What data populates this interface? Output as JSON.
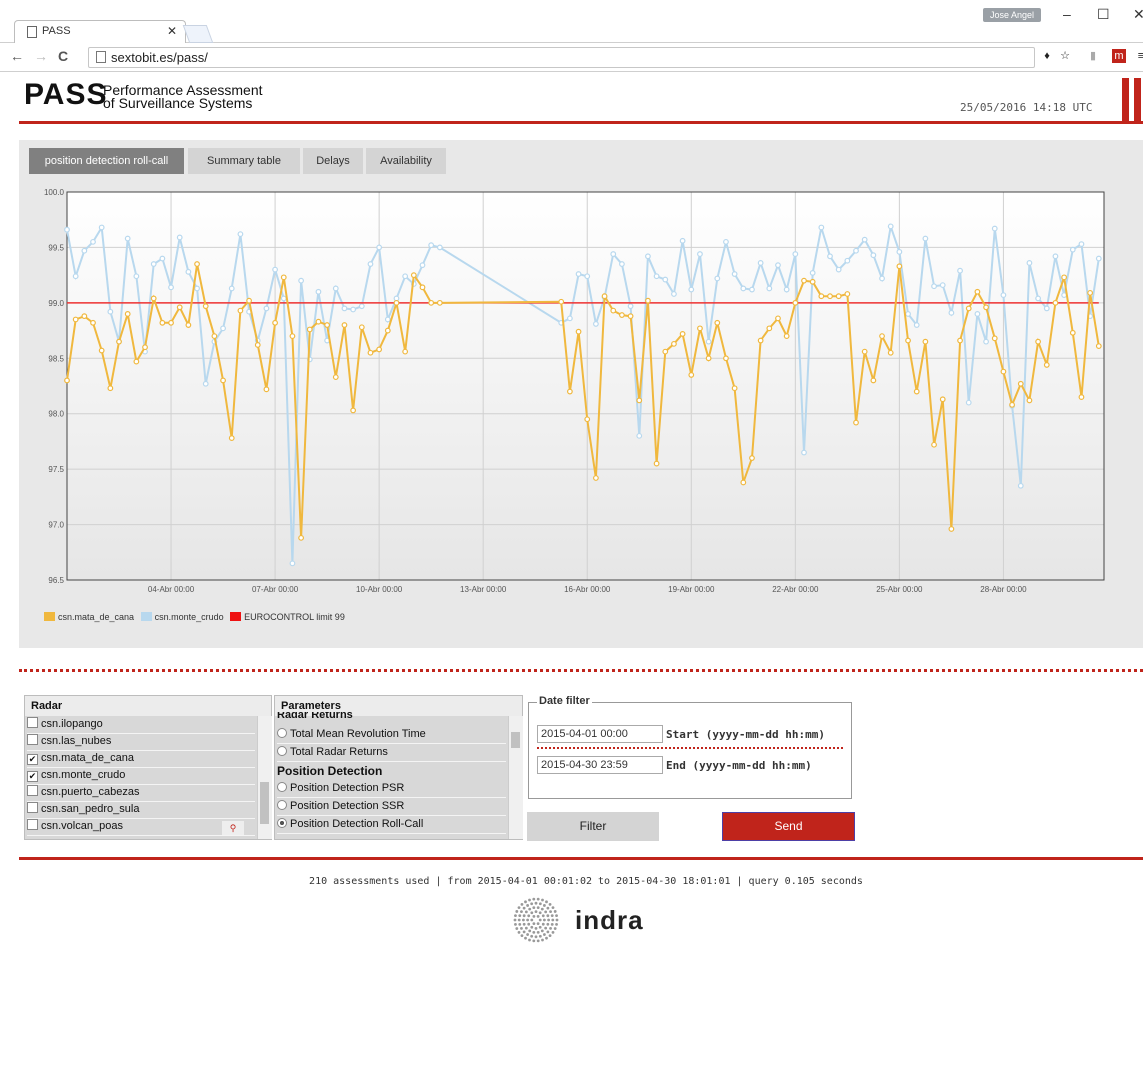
{
  "browser": {
    "tab_title": "PASS",
    "url": "sextobit.es/pass/",
    "user": "Jose Angel"
  },
  "header": {
    "logo": "PASS",
    "subtitle_line1": "Performance Assessment",
    "subtitle_line2": "of Surveillance Systems",
    "datetime": "25/05/2016 14:18 UTC"
  },
  "tabs": [
    {
      "label": "position detection roll-call",
      "active": true
    },
    {
      "label": "Summary table",
      "active": false
    },
    {
      "label": "Delays",
      "active": false
    },
    {
      "label": "Availability",
      "active": false
    }
  ],
  "chart_data": {
    "type": "line",
    "ylim": [
      96.5,
      100.0
    ],
    "yticks": [
      "100.0",
      "99.5",
      "99.0",
      "98.5",
      "98.0",
      "97.5",
      "97.0",
      "96.5"
    ],
    "xticks": [
      "04-Abr 00:00",
      "07-Abr 00:00",
      "10-Abr 00:00",
      "13-Abr 00:00",
      "16-Abr 00:00",
      "19-Abr 00:00",
      "22-Abr 00:00",
      "25-Abr 00:00",
      "28-Abr 00:00"
    ],
    "x_start": "2015-04-01 00:00",
    "x_end": "2015-04-30 23:59",
    "series": [
      {
        "name": "csn.mata_de_cana",
        "color": "#f0b83e",
        "x": [
          1.0,
          1.25,
          1.5,
          1.75,
          2.0,
          2.25,
          2.5,
          2.75,
          3.0,
          3.25,
          3.5,
          3.75,
          4.0,
          4.25,
          4.5,
          4.75,
          5.0,
          5.25,
          5.5,
          5.75,
          6.0,
          6.25,
          6.5,
          6.75,
          7.0,
          7.25,
          7.5,
          7.75,
          8.0,
          8.25,
          8.5,
          8.75,
          9.0,
          9.25,
          9.5,
          9.75,
          10.0,
          10.25,
          10.5,
          10.75,
          11.0,
          11.25,
          11.5,
          11.75,
          15.25,
          15.5,
          15.75,
          16.0,
          16.25,
          16.5,
          16.75,
          17.0,
          17.25,
          17.5,
          17.75,
          18.0,
          18.25,
          18.5,
          18.75,
          19.0,
          19.25,
          19.5,
          19.75,
          20.0,
          20.25,
          20.5,
          20.75,
          21.0,
          21.25,
          21.5,
          21.75,
          22.0,
          22.25,
          22.5,
          22.75,
          23.0,
          23.25,
          23.5,
          23.75,
          24.0,
          24.25,
          24.5,
          24.75,
          25.0,
          25.25,
          25.5,
          25.75,
          26.0,
          26.25,
          26.5,
          26.75,
          27.0,
          27.25,
          27.5,
          27.75,
          28.0,
          28.25,
          28.5,
          28.75,
          29.0,
          29.25,
          29.5,
          29.75,
          30.0,
          30.25,
          30.5,
          30.75
        ],
        "values": [
          98.3,
          98.85,
          98.88,
          98.82,
          98.57,
          98.23,
          98.65,
          98.9,
          98.47,
          98.6,
          99.04,
          98.82,
          98.82,
          98.96,
          98.8,
          99.35,
          98.97,
          98.7,
          98.3,
          97.78,
          98.93,
          99.02,
          98.62,
          98.22,
          98.82,
          99.23,
          98.7,
          96.88,
          98.76,
          98.83,
          98.8,
          98.33,
          98.8,
          98.03,
          98.78,
          98.55,
          98.58,
          98.75,
          99.0,
          98.56,
          99.25,
          99.14,
          99.0,
          99.0,
          99.01,
          98.2,
          98.74,
          97.95,
          97.42,
          99.06,
          98.93,
          98.89,
          98.88,
          98.12,
          99.02,
          97.55,
          98.56,
          98.63,
          98.72,
          98.35,
          98.77,
          98.5,
          98.82,
          98.5,
          98.23,
          97.38,
          97.6,
          98.66,
          98.77,
          98.86,
          98.7,
          99.0,
          99.2,
          99.19,
          99.06,
          99.06,
          99.06,
          99.08,
          97.92,
          98.56,
          98.3,
          98.7,
          98.55,
          99.33,
          98.66,
          98.2,
          98.65,
          97.72,
          98.13,
          96.96,
          98.66,
          98.95,
          99.1,
          98.96,
          98.68,
          98.38,
          98.08,
          98.27,
          98.12,
          98.65,
          98.44,
          99.0,
          99.23,
          98.73,
          98.15,
          99.09,
          98.61
        ]
      },
      {
        "name": "csn.monte_crudo",
        "color": "#b8d8ee",
        "x": [
          1.0,
          1.25,
          1.5,
          1.75,
          2.0,
          2.25,
          2.5,
          2.75,
          3.0,
          3.25,
          3.5,
          3.75,
          4.0,
          4.25,
          4.5,
          4.75,
          5.0,
          5.25,
          5.5,
          5.75,
          6.0,
          6.25,
          6.5,
          6.75,
          7.0,
          7.25,
          7.5,
          7.75,
          8.0,
          8.25,
          8.5,
          8.75,
          9.0,
          9.25,
          9.5,
          9.75,
          10.0,
          10.25,
          10.5,
          10.75,
          11.0,
          11.25,
          11.5,
          11.75,
          15.25,
          15.5,
          15.75,
          16.0,
          16.25,
          16.5,
          16.75,
          17.0,
          17.25,
          17.5,
          17.75,
          18.0,
          18.25,
          18.5,
          18.75,
          19.0,
          19.25,
          19.5,
          19.75,
          20.0,
          20.25,
          20.5,
          20.75,
          21.0,
          21.25,
          21.5,
          21.75,
          22.0,
          22.25,
          22.5,
          22.75,
          23.0,
          23.25,
          23.5,
          23.75,
          24.0,
          24.25,
          24.5,
          24.75,
          25.0,
          25.25,
          25.5,
          25.75,
          26.0,
          26.25,
          26.5,
          26.75,
          27.0,
          27.25,
          27.5,
          27.75,
          28.0,
          28.25,
          28.5,
          28.75,
          29.0,
          29.25,
          29.5,
          29.75,
          30.0,
          30.25,
          30.5,
          30.75
        ],
        "values": [
          99.66,
          99.24,
          99.47,
          99.55,
          99.68,
          98.92,
          98.65,
          99.58,
          99.24,
          98.56,
          99.35,
          99.4,
          99.14,
          99.59,
          99.28,
          99.13,
          98.27,
          98.65,
          98.77,
          99.13,
          99.62,
          98.92,
          98.66,
          98.95,
          99.3,
          99.04,
          96.65,
          99.2,
          98.49,
          99.1,
          98.66,
          99.13,
          98.95,
          98.94,
          98.97,
          99.35,
          99.5,
          98.85,
          99.04,
          99.24,
          99.17,
          99.34,
          99.52,
          99.5,
          98.82,
          98.86,
          99.26,
          99.24,
          98.81,
          99.05,
          99.44,
          99.35,
          98.97,
          97.8,
          99.42,
          99.24,
          99.21,
          99.08,
          99.56,
          99.12,
          99.44,
          98.65,
          99.22,
          99.55,
          99.26,
          99.13,
          99.12,
          99.36,
          99.13,
          99.34,
          99.12,
          99.44,
          97.65,
          99.27,
          99.68,
          99.42,
          99.3,
          99.38,
          99.47,
          99.57,
          99.43,
          99.22,
          99.69,
          99.46,
          98.9,
          98.8,
          99.58,
          99.15,
          99.16,
          98.91,
          99.29,
          98.1,
          98.9,
          98.65,
          99.67,
          99.07,
          98.07,
          97.35,
          99.36,
          99.04,
          98.95,
          99.42,
          99.07,
          99.48,
          99.53,
          98.88,
          99.4
        ]
      },
      {
        "name": "EUROCONTROL limit 99",
        "color": "#ee3333",
        "x": [
          1.0,
          30.75
        ],
        "values": [
          99.0,
          99.0
        ]
      }
    ]
  },
  "filters": {
    "radar_header": "Radar",
    "radar_items": [
      {
        "label": "csn.ilopango",
        "checked": false
      },
      {
        "label": "csn.las_nubes",
        "checked": false
      },
      {
        "label": "csn.mata_de_cana",
        "checked": true
      },
      {
        "label": "csn.monte_crudo",
        "checked": true
      },
      {
        "label": "csn.puerto_cabezas",
        "checked": false
      },
      {
        "label": "csn.san_pedro_sula",
        "checked": false
      },
      {
        "label": "csn.volcan_poas",
        "checked": false
      }
    ],
    "params_header": "Parameters",
    "params_cut_group": "Radar Returns",
    "params_items_a": [
      {
        "label": "Total Mean Revolution Time",
        "selected": false
      },
      {
        "label": "Total Radar Returns",
        "selected": false
      }
    ],
    "params_group": "Position Detection",
    "params_items_b": [
      {
        "label": "Position Detection PSR",
        "selected": false
      },
      {
        "label": "Position Detection SSR",
        "selected": false
      },
      {
        "label": "Position Detection Roll-Call",
        "selected": true
      }
    ],
    "date_filter_title": "Date filter",
    "start_value": "2015-04-01 00:00",
    "start_label": "Start (yyyy-mm-dd hh:mm)",
    "end_value": "2015-04-30 23:59",
    "end_label": "End (yyyy-mm-dd hh:mm)",
    "filter_button": "Filter",
    "send_button": "Send"
  },
  "footer": {
    "stats": "210 assessments used | from 2015-04-01 00:01:02 to 2015-04-30 18:01:01 | query 0.105 seconds",
    "brand": "indra"
  }
}
